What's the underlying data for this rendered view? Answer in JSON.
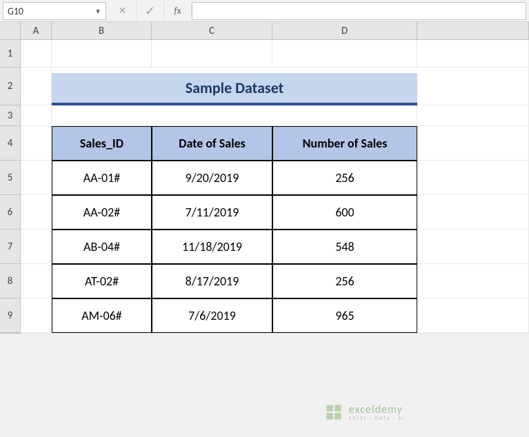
{
  "name_box": "G10",
  "fx_label": "fx",
  "formula_value": "",
  "columns": [
    "A",
    "B",
    "C",
    "D"
  ],
  "rows": [
    "1",
    "2",
    "3",
    "4",
    "5",
    "6",
    "7",
    "8",
    "9"
  ],
  "title": "Sample Dataset",
  "table": {
    "headers": [
      "Sales_ID",
      "Date of Sales",
      "Number of Sales"
    ],
    "rows": [
      [
        "AA-01#",
        "9/20/2019",
        "256"
      ],
      [
        "AA-02#",
        "7/11/2019",
        "600"
      ],
      [
        "AB-04#",
        "11/18/2019",
        "548"
      ],
      [
        "AT-02#",
        "8/17/2019",
        "256"
      ],
      [
        "AM-06#",
        "7/6/2019",
        "965"
      ]
    ]
  },
  "watermark": {
    "brand": "exceldemy",
    "tag": "EXCEL · DATA · BI"
  }
}
